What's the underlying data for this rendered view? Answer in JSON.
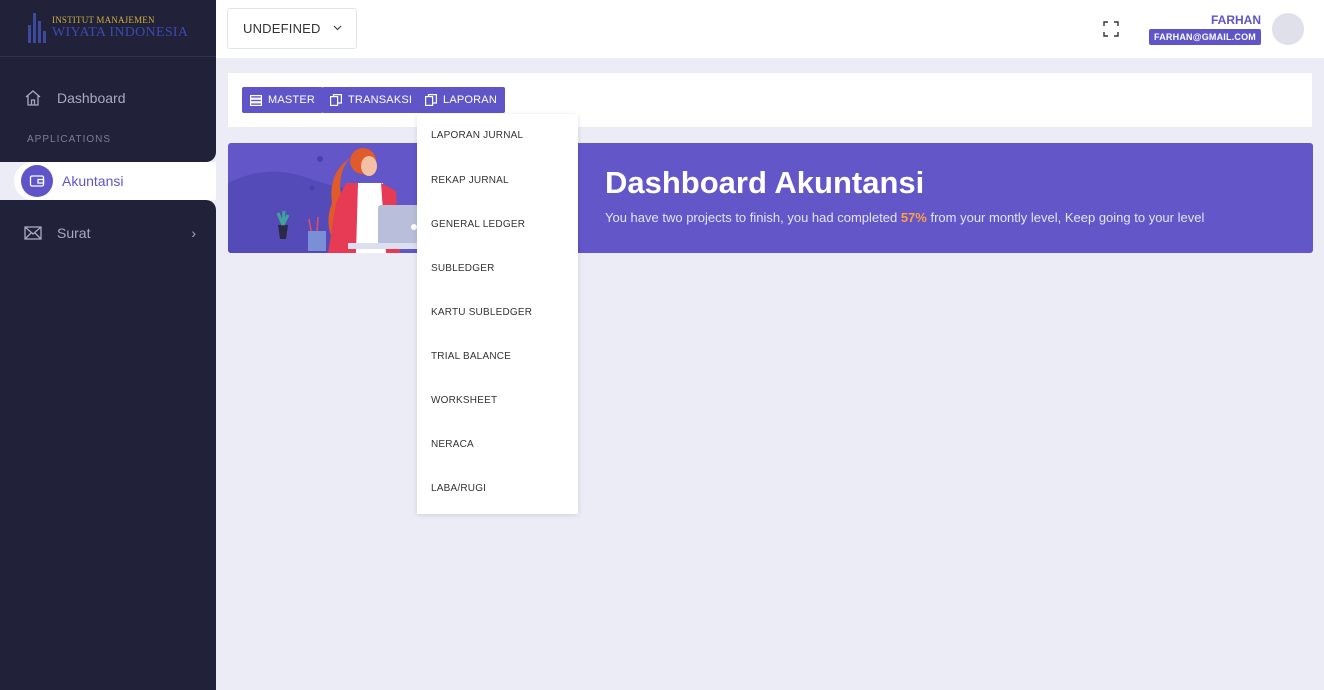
{
  "brand": {
    "line1": "INSTITUT MANAJEMEN",
    "line2": "WIYATA INDONESIA"
  },
  "sidebar": {
    "dashboard_label": "Dashboard",
    "section_label": "APPLICATIONS",
    "active_label": "Akuntansi",
    "surat_label": "Surat"
  },
  "header": {
    "select_value": "UNDEFINED",
    "user_name": "FARHAN",
    "user_email": "FARHAN@GMAIL.COM"
  },
  "toolbar": {
    "master_label": "MASTER",
    "transaksi_label": "TRANSAKSI",
    "laporan_label": "LAPORAN"
  },
  "banner": {
    "title": "Dashboard Akuntansi",
    "sub_before": "You have two projects to finish, you had completed ",
    "sub_pct": "57%",
    "sub_after": " from your montly level, Keep going to your level"
  },
  "dropdown": {
    "items": [
      "LAPORAN JURNAL",
      "REKAP JURNAL",
      "GENERAL LEDGER",
      "SUBLEDGER",
      "KARTU SUBLEDGER",
      "TRIAL BALANCE",
      "WORKSHEET",
      "NERACA",
      "LABA/RUGI"
    ]
  },
  "colors": {
    "accent": "#5f55c9",
    "sidebar": "#22213a",
    "background": "#ebecf5",
    "highlight": "#ff9f43"
  },
  "icons": [
    "home-icon",
    "wallet-icon",
    "mail-icon",
    "chevron-right-icon",
    "chevron-down-icon",
    "fullscreen-icon",
    "list-icon",
    "copy-icon"
  ]
}
